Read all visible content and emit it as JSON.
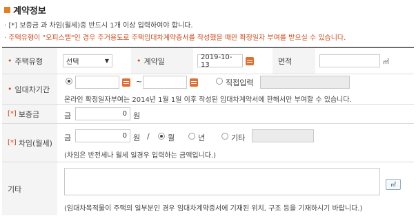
{
  "section": {
    "title": "계약정보"
  },
  "notes": {
    "note1": "· [*] 보증금 과 차임(월세)중 반드시 1개 이상 입력하여야 합니다.",
    "note2": "· 주택유형이 \"오피스텔\"인 경우 주거용도로 주택임대차계약증서를 작성했을 때만 확정일자 부여를 받으실 수 있습니다."
  },
  "row1": {
    "type_label": "주택유형",
    "type_value": "선택",
    "date_label": "계약일",
    "date_value": "2019-10-13",
    "area_label": "면적",
    "area_value": "",
    "area_unit": "㎡"
  },
  "row2": {
    "label": "임대차기간",
    "start_value": "",
    "tilde": "~",
    "end_value": "",
    "direct_label": "직접입력",
    "info": "온라인 확정일자부여는 2014년 1월 1일 이후 작성된 임대차계약서에 한해서만 부여할 수 있습니다."
  },
  "row3": {
    "label": "보증금",
    "bracket": "[*]",
    "prefix": "금",
    "value": "0",
    "unit": "원"
  },
  "row4": {
    "label": "차임(월세)",
    "bracket": "[*]",
    "prefix": "금",
    "value": "0",
    "unit": "원",
    "slash": "/",
    "opt_month": "월",
    "opt_year": "년",
    "opt_other": "기타",
    "note": "(차임은 반전세나 월세 일경우 입력하는 금액입니다.)"
  },
  "row5": {
    "label": "기타",
    "btn": "㎡",
    "note": "(임대차목적물이 주택의 일부분인 경우 임대차계약증서에 기재된 위치, 구조 등을 기재하시기 바랍니다.)"
  },
  "colors": {
    "accent": "#e67e22",
    "required": "#d04a1a"
  }
}
